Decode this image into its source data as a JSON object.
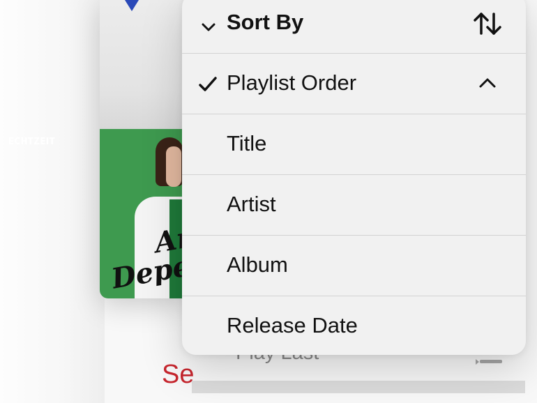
{
  "background": {
    "album_art_label": "ECHTZEIT",
    "album_art_script_line1": "An",
    "album_art_script_line2": "Deper",
    "under_menu_item": "Play Last",
    "red_link_partial": "Se"
  },
  "sort_menu": {
    "title": "Sort By",
    "header_icon": "sort-arrows-icon",
    "options": [
      {
        "label": "Playlist Order",
        "selected": true
      },
      {
        "label": "Title",
        "selected": false
      },
      {
        "label": "Artist",
        "selected": false
      },
      {
        "label": "Album",
        "selected": false
      },
      {
        "label": "Release Date",
        "selected": false
      }
    ]
  },
  "colors": {
    "accent_red": "#c8262e",
    "album_green": "#3e9a4f",
    "menu_bg": "#f1f1f1"
  }
}
